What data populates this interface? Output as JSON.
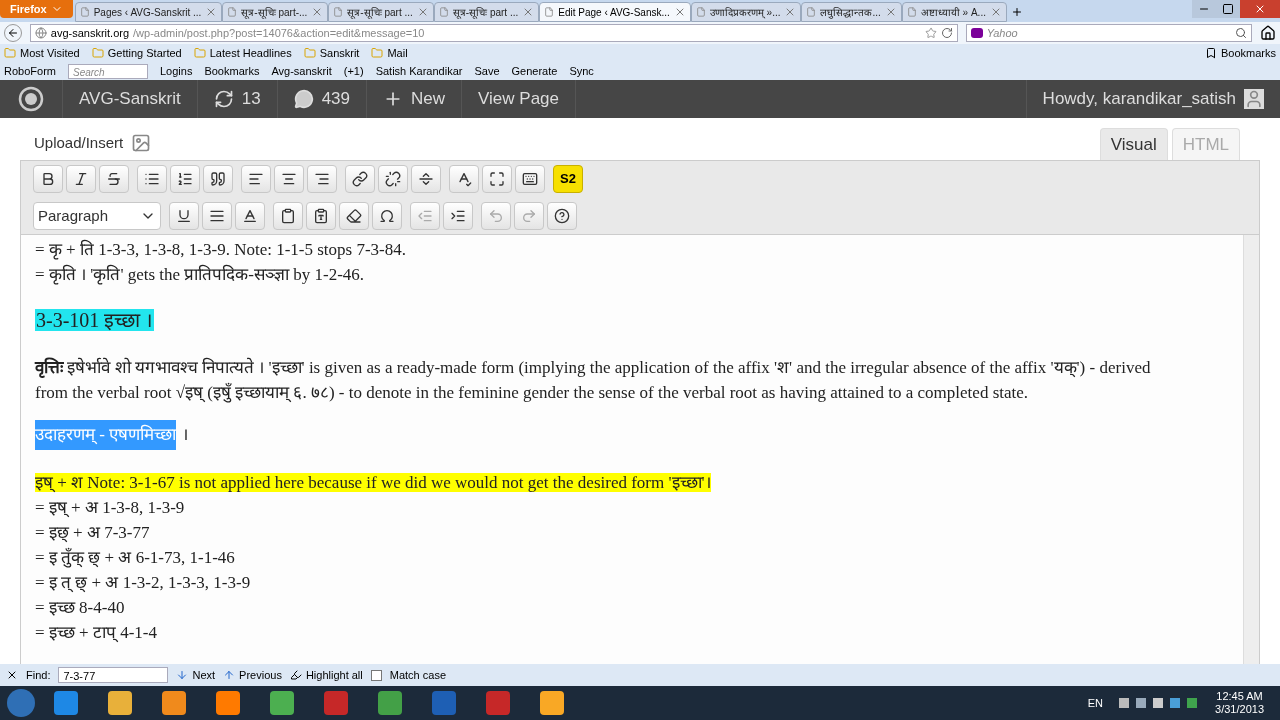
{
  "browser": {
    "menu_button": "Firefox",
    "tabs": [
      {
        "title": "Pages ‹ AVG-Sanskrit ...",
        "selected": false
      },
      {
        "title": "सूत्र-सूचिः part-...",
        "selected": false
      },
      {
        "title": "सूत्र-सूचिः part ...",
        "selected": false
      },
      {
        "title": "सूत्र-सूचिः part ...",
        "selected": false
      },
      {
        "title": "Edit Page ‹ AVG-Sansk...",
        "selected": true
      },
      {
        "title": "उणादिप्रकरणम् »...",
        "selected": false
      },
      {
        "title": "लघुसिद्धान्तक...",
        "selected": false
      },
      {
        "title": "अष्टाध्यायी » A...",
        "selected": false
      }
    ],
    "url_host": "avg-sanskrit.org",
    "url_path": "/wp-admin/post.php?post=14076&action=edit&message=10",
    "search_placeholder": "Yahoo",
    "bookmarks": [
      "Most Visited",
      "Getting Started",
      "Latest Headlines",
      "Sanskrit",
      "Mail"
    ],
    "bookmarks_menu": "Bookmarks",
    "roboform": {
      "label": "RoboForm",
      "search_placeholder": "Search",
      "items": [
        "Logins",
        "Bookmarks",
        "Avg-sanskrit",
        "(+1)",
        "Satish Karandikar",
        "Save",
        "Generate",
        "Sync"
      ]
    }
  },
  "admin_bar": {
    "site": "AVG-Sanskrit",
    "updates": "13",
    "comments": "439",
    "new": "New",
    "view": "View Page",
    "howdy": "Howdy, karandikar_satish"
  },
  "editor": {
    "upload": "Upload/Insert",
    "modes": [
      {
        "label": "Visual",
        "selected": true
      },
      {
        "label": "HTML",
        "selected": false
      }
    ],
    "format": "Paragraph",
    "plugin": "S2",
    "content": [
      {
        "kind": "line",
        "text": "= कृ + ति 1-3-3, 1-3-8, 1-3-9. Note: 1-1-5 stops 7-3-84."
      },
      {
        "kind": "line",
        "text": "= कृति । 'कृति' gets the प्रातिपदिक-सञ्ज्ञा by 1-2-46."
      },
      {
        "kind": "heading",
        "text": "3-3-101 इच्छा ।"
      },
      {
        "kind": "para",
        "text": "**वृत्तिः** इषेर्भावे शो यगभावश्च निपात्यते । 'इच्छा' is given as a ready-made form (implying the application of the affix 'श' and the irregular absence of the affix 'यक्') - derived from the verbal root √इष् (इषुँ इच्छायाम् ६. ७८) - to denote in the feminine gender the sense of the verbal root as having attained to a completed state."
      },
      {
        "kind": "selection",
        "text": "उदाहरणम् - एषणमिच्छा",
        "rest": "।"
      },
      {
        "kind": "highlight",
        "text": "इष् + श Note: 3-1-67 is not applied here because if we did we would not get the desired form 'इच्छा'।"
      },
      {
        "kind": "line",
        "text": "= इष् + अ 1-3-8, 1-3-9"
      },
      {
        "kind": "line",
        "text": "= इछ् + अ 7-3-77"
      },
      {
        "kind": "line",
        "text": "= इ तुँक् छ् + अ 6-1-73, 1-1-46"
      },
      {
        "kind": "line",
        "text": "= इ त् छ् + अ 1-3-2, 1-3-3, 1-3-9"
      },
      {
        "kind": "line",
        "text": "= इच्छ 8-4-40"
      },
      {
        "kind": "line",
        "text": "= इच्छ + टाप् 4-1-4"
      }
    ]
  },
  "find_bar": {
    "label": "Find:",
    "value": "7-3-77",
    "next": "Next",
    "previous": "Previous",
    "highlight": "Highlight all",
    "match_case": {
      "label": "Match case",
      "checked": false
    }
  },
  "taskbar": {
    "language": "EN",
    "time": "12:45 AM",
    "date": "3/31/2013"
  }
}
